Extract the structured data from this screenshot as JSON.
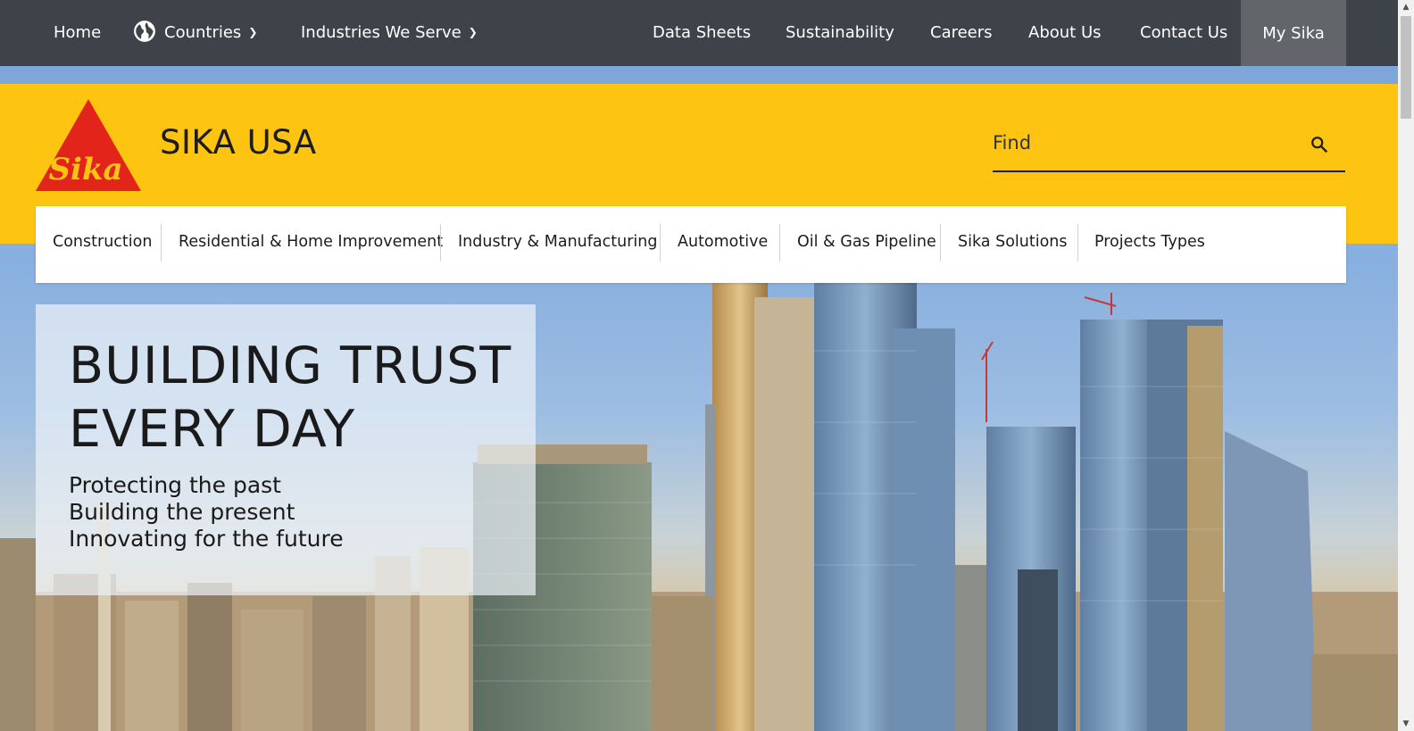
{
  "topnav": {
    "home": "Home",
    "countries": "Countries",
    "industries": "Industries We Serve",
    "data_sheets": "Data Sheets",
    "sustainability": "Sustainability",
    "careers": "Careers",
    "about_us": "About Us",
    "contact_us": "Contact Us",
    "my_sika": "My Sika"
  },
  "header": {
    "logo_text": "Sika",
    "brand": "SIKA USA",
    "search_placeholder": "Find"
  },
  "categories": [
    "Construction",
    "Residential & Home Improvement",
    "Industry & Manufacturing",
    "Automotive",
    "Oil & Gas Pipeline",
    "Sika Solutions",
    "Projects Types"
  ],
  "hero": {
    "title_line1": "BUILDING TRUST",
    "title_line2": "EVERY DAY",
    "line1": "Protecting the past",
    "line2": "Building the present",
    "line3": "Innovating for the future"
  },
  "colors": {
    "topbar": "#3e4349",
    "brand_yellow": "#fdc511",
    "logo_red": "#e3241b",
    "my_sika_bg": "#62666b"
  },
  "icons": {
    "globe": "globe-icon",
    "chevron": "chevron-down-icon",
    "search": "search-icon"
  }
}
